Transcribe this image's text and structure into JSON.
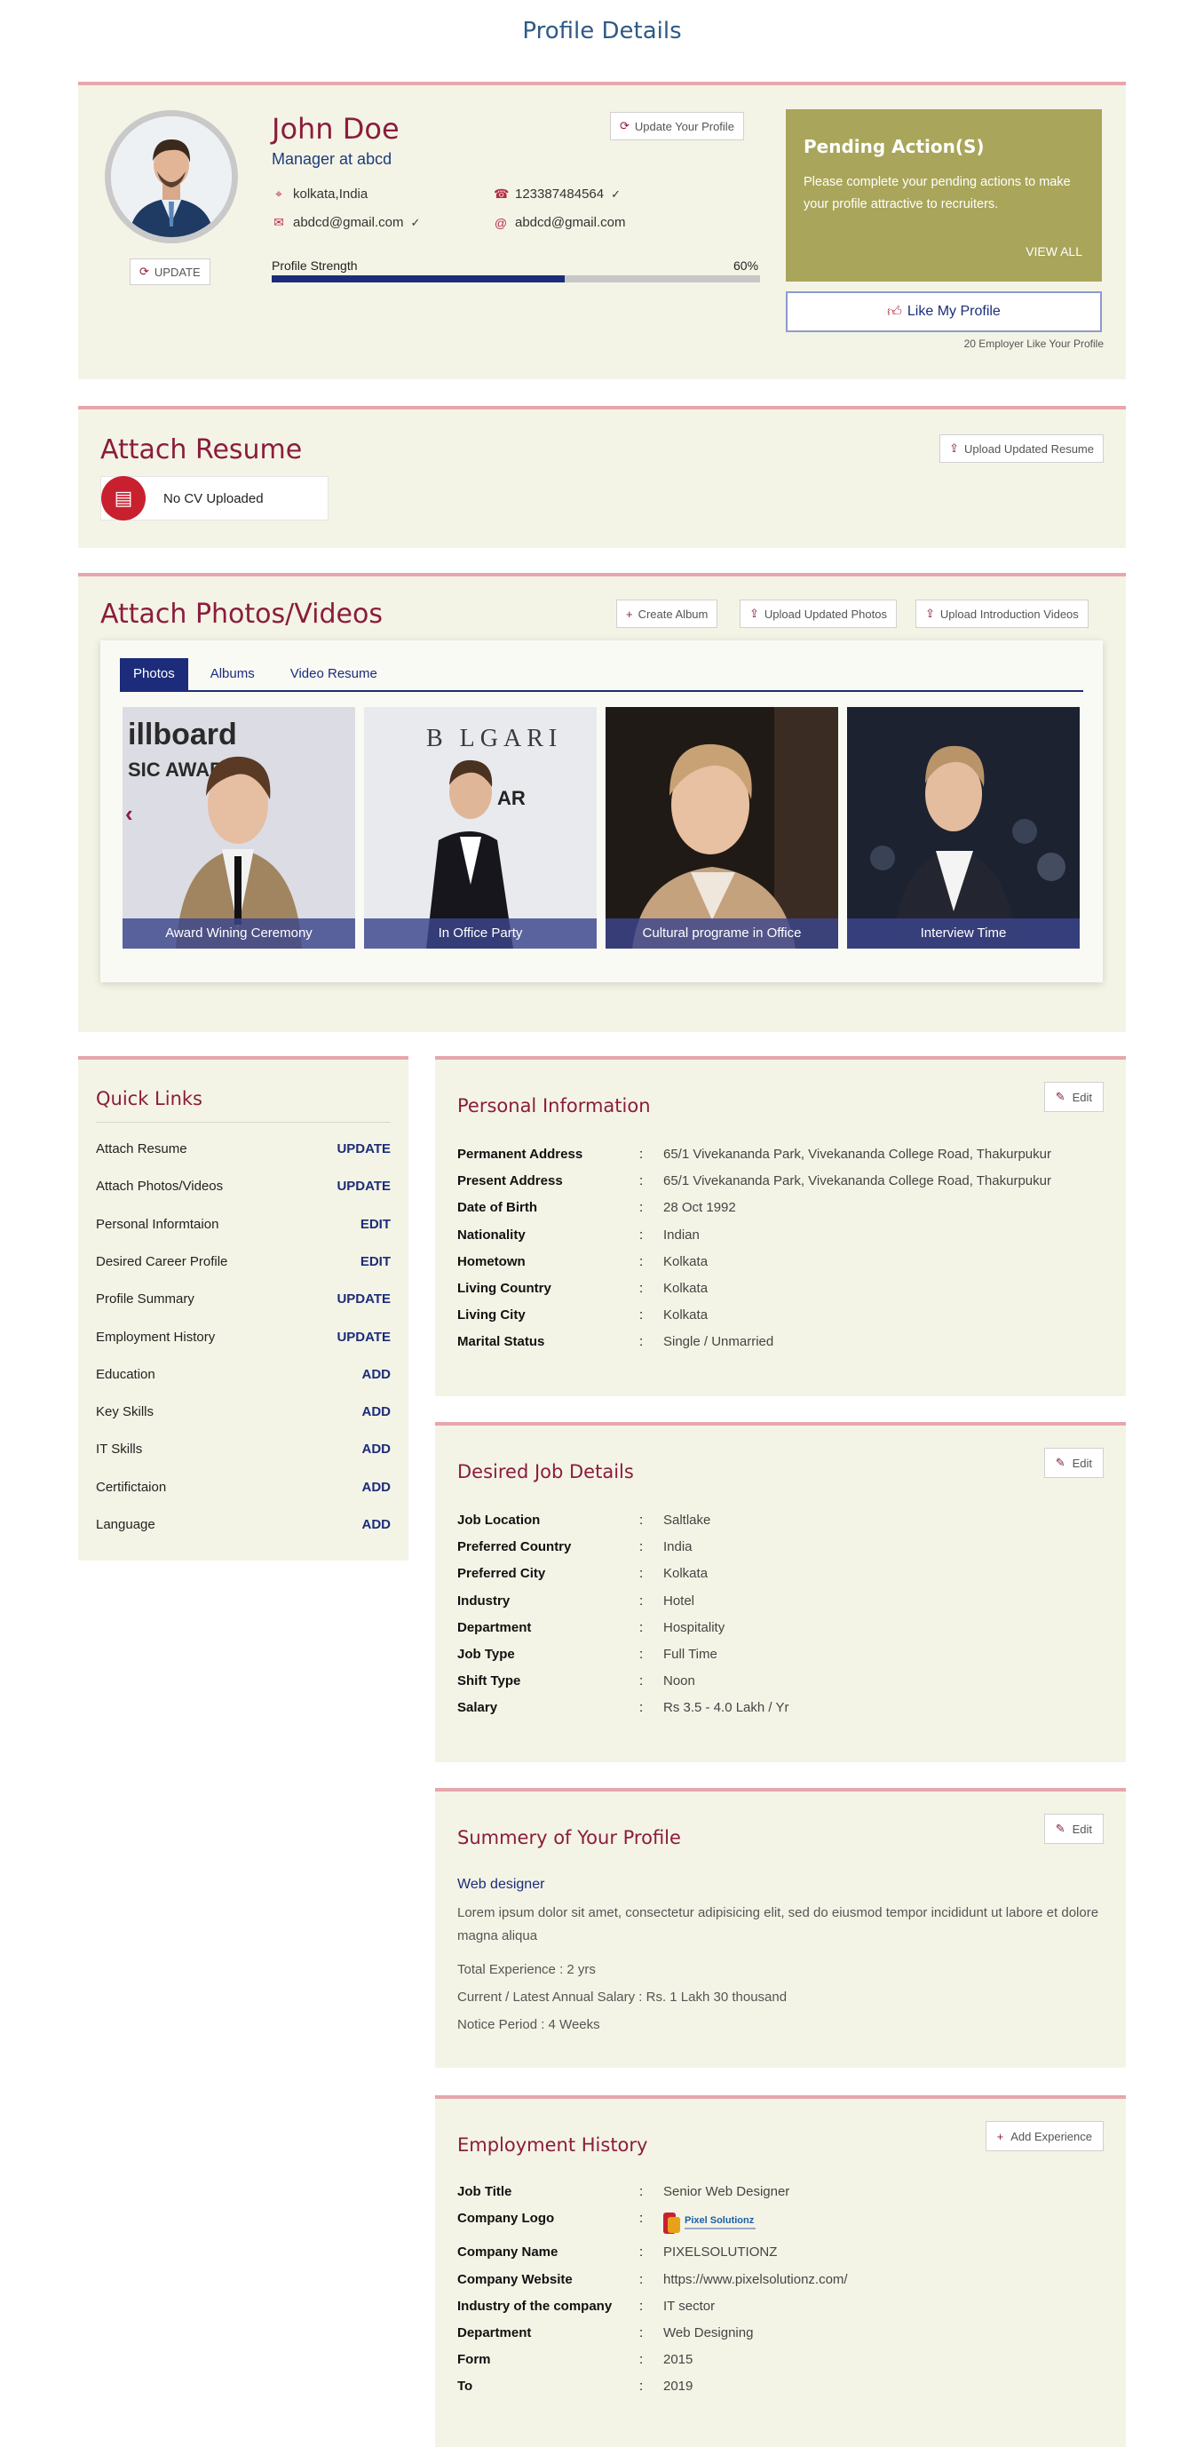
{
  "page": {
    "title": "Profile Details"
  },
  "profile": {
    "name": "John Doe",
    "designation": "Manager at abcd",
    "location": "kolkata,India",
    "phone": "123387484564",
    "email1": "abdcd@gmail.com",
    "email2": "abdcd@gmail.com",
    "update_photo_label": "UPDATE",
    "update_profile_label": "Update Your Profile",
    "strength_label": "Profile Strength",
    "strength_value": "60%",
    "strength_fraction": 0.6
  },
  "pending": {
    "title": "Pending Action(S)",
    "text": "Please complete your pending actions to make your profile attractive to recruiters.",
    "view_all": "VIEW ALL",
    "like_label": "Like My Profile",
    "like_count": "20 Employer Like Your Profile"
  },
  "resume": {
    "title": "Attach Resume",
    "upload_label": "Upload Updated Resume",
    "status": "No CV Uploaded"
  },
  "media": {
    "title": "Attach Photos/Videos",
    "buttons": [
      "Create Album",
      "Upload Updated Photos",
      "Upload Introduction Videos"
    ],
    "tabs": [
      "Photos",
      "Albums",
      "Video Resume"
    ],
    "photos": [
      {
        "caption": "Award Wining Ceremony"
      },
      {
        "caption": "In Office Party"
      },
      {
        "caption": "Cultural programe in Office"
      },
      {
        "caption": "Interview Time"
      }
    ]
  },
  "quick_links": {
    "title": "Quick Links",
    "items": [
      {
        "label": "Attach Resume",
        "action": "UPDATE"
      },
      {
        "label": "Attach Photos/Videos",
        "action": "UPDATE"
      },
      {
        "label": "Personal Informtaion",
        "action": "EDIT"
      },
      {
        "label": "Desired Career Profile",
        "action": "EDIT"
      },
      {
        "label": "Profile Summary",
        "action": "UPDATE"
      },
      {
        "label": "Employment History",
        "action": "UPDATE"
      },
      {
        "label": "Education",
        "action": "ADD"
      },
      {
        "label": "Key Skills",
        "action": "ADD"
      },
      {
        "label": "IT Skills",
        "action": "ADD"
      },
      {
        "label": "Certifictaion",
        "action": "ADD"
      },
      {
        "label": "Language",
        "action": "ADD"
      }
    ]
  },
  "personal": {
    "title": "Personal Information",
    "edit_label": "Edit",
    "rows": [
      {
        "k": "Permanent Address",
        "v": "65/1 Vivekananda Park, Vivekananda College Road, Thakurpukur"
      },
      {
        "k": "Present Address",
        "v": "65/1 Vivekananda Park, Vivekananda College Road, Thakurpukur"
      },
      {
        "k": "Date of Birth",
        "v": "28 Oct 1992"
      },
      {
        "k": "Nationality",
        "v": "Indian"
      },
      {
        "k": "Hometown",
        "v": "Kolkata"
      },
      {
        "k": "Living Country",
        "v": "Kolkata"
      },
      {
        "k": "Living City",
        "v": "Kolkata"
      },
      {
        "k": "Marital Status",
        "v": "Single / Unmarried"
      }
    ]
  },
  "desired": {
    "title": "Desired Job Details",
    "edit_label": "Edit",
    "rows": [
      {
        "k": "Job Location",
        "v": "Saltlake"
      },
      {
        "k": "Preferred Country",
        "v": "India"
      },
      {
        "k": "Preferred City",
        "v": "Kolkata"
      },
      {
        "k": "Industry",
        "v": "Hotel"
      },
      {
        "k": "Department",
        "v": "Hospitality"
      },
      {
        "k": "Job Type",
        "v": "Full Time"
      },
      {
        "k": "Shift Type",
        "v": "Noon"
      },
      {
        "k": "Salary",
        "v": "Rs 3.5 - 4.0 Lakh / Yr"
      }
    ]
  },
  "summary": {
    "title": "Summery of Your Profile",
    "edit_label": "Edit",
    "headline": "Web designer",
    "text": "Lorem ipsum dolor sit amet, consectetur adipisicing elit, sed do eiusmod tempor incididunt ut labore et dolore magna aliqua",
    "experience": "Total Experience : 2 yrs",
    "salary": "Current / Latest Annual Salary : Rs. 1 Lakh 30 thousand",
    "notice": "Notice Period : 4 Weeks"
  },
  "employment": {
    "title": "Employment History",
    "add_label": "Add Experience",
    "logo_text": "Pixel Solutionz",
    "rows": [
      {
        "k": "Job Title",
        "v": "Senior Web Designer"
      },
      {
        "k": "Company Logo",
        "v": ""
      },
      {
        "k": "Company Name",
        "v": "PIXELSOLUTIONZ"
      },
      {
        "k": "Company Website",
        "v": "https://www.pixelsolutionz.com/"
      },
      {
        "k": "Industry of the company",
        "v": "IT sector"
      },
      {
        "k": "Department",
        "v": "Web Designing"
      },
      {
        "k": "Form",
        "v": "2015"
      },
      {
        "k": "To",
        "v": "2019"
      }
    ]
  },
  "colors": {
    "accent": "#8b1c3c",
    "navy": "#1c2c7a",
    "card_bg": "#f4f4e6",
    "pending_bg": "#a9a55a"
  }
}
